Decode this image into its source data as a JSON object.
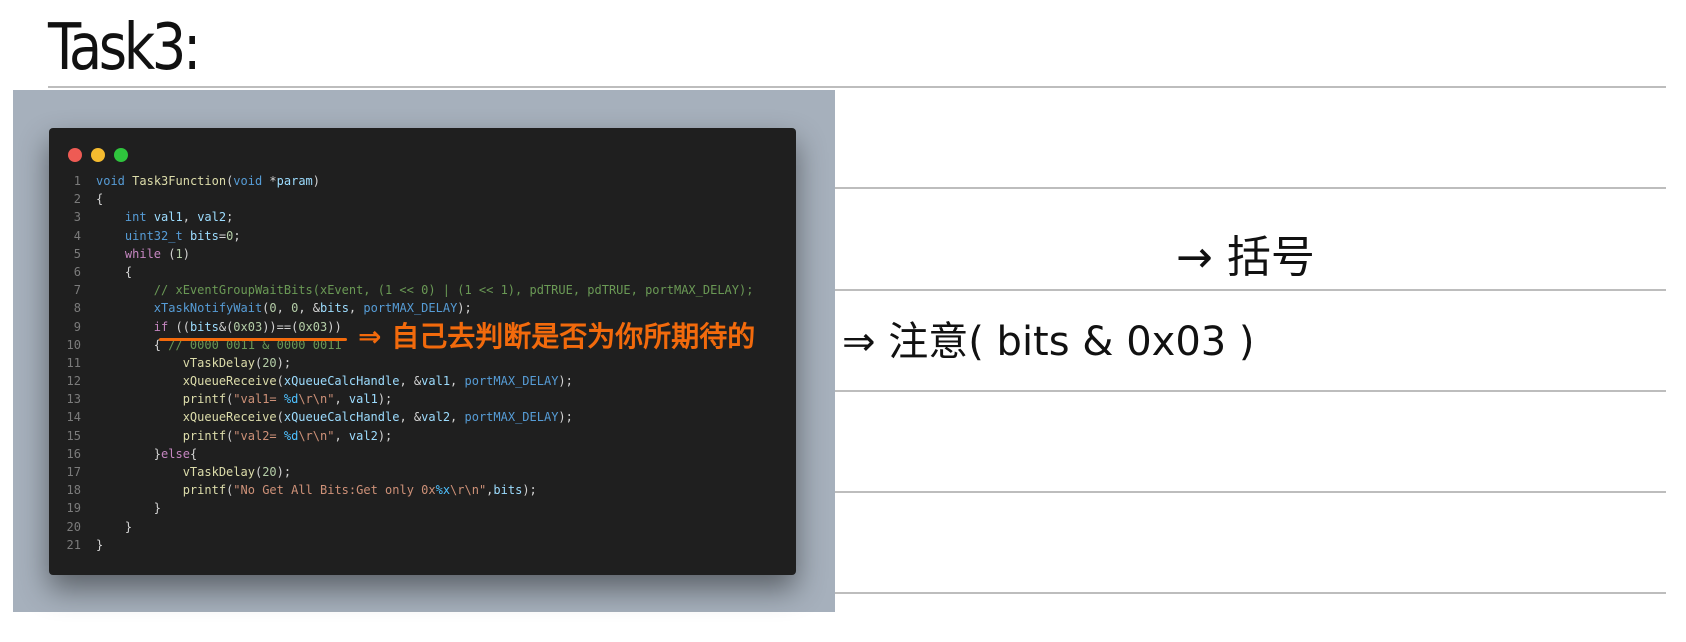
{
  "page": {
    "heading": "Task3:"
  },
  "code_window": {
    "traffic_lights": [
      {
        "name": "close",
        "color": "#ee5b54"
      },
      {
        "name": "minimize",
        "color": "#f5bb2f"
      },
      {
        "name": "maximize",
        "color": "#2fc43d"
      }
    ],
    "lines": [
      {
        "n": "1",
        "tokens": [
          [
            "kw",
            "void"
          ],
          [
            "plain",
            " "
          ],
          [
            "fn",
            "Task3Function"
          ],
          [
            "plain",
            "("
          ],
          [
            "kw",
            "void"
          ],
          [
            "plain",
            " *"
          ],
          [
            "var",
            "param"
          ],
          [
            "plain",
            ")"
          ]
        ]
      },
      {
        "n": "2",
        "tokens": [
          [
            "plain",
            "{"
          ]
        ]
      },
      {
        "n": "3",
        "tokens": [
          [
            "plain",
            "    "
          ],
          [
            "kw",
            "int"
          ],
          [
            "plain",
            " "
          ],
          [
            "var",
            "val1"
          ],
          [
            "plain",
            ", "
          ],
          [
            "var",
            "val2"
          ],
          [
            "plain",
            ";"
          ]
        ]
      },
      {
        "n": "4",
        "tokens": [
          [
            "plain",
            "    "
          ],
          [
            "kw",
            "uint32_t"
          ],
          [
            "plain",
            " "
          ],
          [
            "var",
            "bits"
          ],
          [
            "plain",
            "="
          ],
          [
            "num",
            "0"
          ],
          [
            "plain",
            ";"
          ]
        ]
      },
      {
        "n": "5",
        "tokens": [
          [
            "plain",
            "    "
          ],
          [
            "ctrl",
            "while"
          ],
          [
            "plain",
            " ("
          ],
          [
            "num",
            "1"
          ],
          [
            "plain",
            ")"
          ]
        ]
      },
      {
        "n": "6",
        "tokens": [
          [
            "plain",
            "    {"
          ]
        ]
      },
      {
        "n": "7",
        "tokens": [
          [
            "plain",
            "        "
          ],
          [
            "cmt",
            "// xEventGroupWaitBits(xEvent, (1 << 0) | (1 << 1), pdTRUE, pdTRUE, portMAX_DELAY);"
          ]
        ]
      },
      {
        "n": "8",
        "tokens": [
          [
            "plain",
            "        "
          ],
          [
            "kw",
            "xTaskNotifyWait"
          ],
          [
            "plain",
            "("
          ],
          [
            "num",
            "0"
          ],
          [
            "plain",
            ", "
          ],
          [
            "num",
            "0"
          ],
          [
            "plain",
            ", &"
          ],
          [
            "var",
            "bits"
          ],
          [
            "plain",
            ", "
          ],
          [
            "kw",
            "portMAX_DELAY"
          ],
          [
            "plain",
            ");"
          ]
        ]
      },
      {
        "n": "9",
        "tokens": [
          [
            "plain",
            "        "
          ],
          [
            "ctrl",
            "if"
          ],
          [
            "plain",
            " (("
          ],
          [
            "var",
            "bits"
          ],
          [
            "plain",
            "&("
          ],
          [
            "num",
            "0x03"
          ],
          [
            "plain",
            "))==("
          ],
          [
            "num",
            "0x03"
          ],
          [
            "plain",
            "))"
          ]
        ]
      },
      {
        "n": "10",
        "tokens": [
          [
            "plain",
            "        { "
          ],
          [
            "cmt",
            "// 0000 0011 & 0000 0011"
          ]
        ]
      },
      {
        "n": "11",
        "tokens": [
          [
            "plain",
            "            "
          ],
          [
            "fn",
            "vTaskDelay"
          ],
          [
            "plain",
            "("
          ],
          [
            "num",
            "20"
          ],
          [
            "plain",
            ");"
          ]
        ]
      },
      {
        "n": "12",
        "tokens": [
          [
            "plain",
            "            "
          ],
          [
            "fn",
            "xQueueReceive"
          ],
          [
            "plain",
            "("
          ],
          [
            "var",
            "xQueueCalcHandle"
          ],
          [
            "plain",
            ", &"
          ],
          [
            "var",
            "val1"
          ],
          [
            "plain",
            ", "
          ],
          [
            "kw",
            "portMAX_DELAY"
          ],
          [
            "plain",
            ");"
          ]
        ]
      },
      {
        "n": "13",
        "tokens": [
          [
            "plain",
            "            "
          ],
          [
            "fn",
            "printf"
          ],
          [
            "plain",
            "("
          ],
          [
            "str",
            "\"val1= "
          ],
          [
            "const",
            "%d"
          ],
          [
            "str",
            "\\r\\n\""
          ],
          [
            "plain",
            ", "
          ],
          [
            "var",
            "val1"
          ],
          [
            "plain",
            ");"
          ]
        ]
      },
      {
        "n": "14",
        "tokens": [
          [
            "plain",
            "            "
          ],
          [
            "fn",
            "xQueueReceive"
          ],
          [
            "plain",
            "("
          ],
          [
            "var",
            "xQueueCalcHandle"
          ],
          [
            "plain",
            ", &"
          ],
          [
            "var",
            "val2"
          ],
          [
            "plain",
            ", "
          ],
          [
            "kw",
            "portMAX_DELAY"
          ],
          [
            "plain",
            ");"
          ]
        ]
      },
      {
        "n": "15",
        "tokens": [
          [
            "plain",
            "            "
          ],
          [
            "fn",
            "printf"
          ],
          [
            "plain",
            "("
          ],
          [
            "str",
            "\"val2= "
          ],
          [
            "const",
            "%d"
          ],
          [
            "str",
            "\\r\\n\""
          ],
          [
            "plain",
            ", "
          ],
          [
            "var",
            "val2"
          ],
          [
            "plain",
            ");"
          ]
        ]
      },
      {
        "n": "16",
        "tokens": [
          [
            "plain",
            "        }"
          ],
          [
            "ctrl",
            "else"
          ],
          [
            "plain",
            "{"
          ]
        ]
      },
      {
        "n": "17",
        "tokens": [
          [
            "plain",
            "            "
          ],
          [
            "fn",
            "vTaskDelay"
          ],
          [
            "plain",
            "("
          ],
          [
            "num",
            "20"
          ],
          [
            "plain",
            ");"
          ]
        ]
      },
      {
        "n": "18",
        "tokens": [
          [
            "plain",
            "            "
          ],
          [
            "fn",
            "printf"
          ],
          [
            "plain",
            "("
          ],
          [
            "str",
            "\"No Get All Bits:Get only 0x"
          ],
          [
            "const",
            "%x"
          ],
          [
            "str",
            "\\r\\n\""
          ],
          [
            "plain",
            ","
          ],
          [
            "var",
            "bits"
          ],
          [
            "plain",
            ");"
          ]
        ]
      },
      {
        "n": "19",
        "tokens": [
          [
            "plain",
            "        }"
          ]
        ]
      },
      {
        "n": "20",
        "tokens": [
          [
            "plain",
            "    }"
          ]
        ]
      },
      {
        "n": "21",
        "tokens": [
          [
            "plain",
            "}"
          ]
        ]
      }
    ]
  },
  "annotations": {
    "orange_note": "⇒ 自己去判断是否为你所期待的",
    "orange_color": "#f26a0c",
    "note_attention": "⇒ 注意( bits & 0x03 )",
    "note_brackets": "→ 括号"
  }
}
